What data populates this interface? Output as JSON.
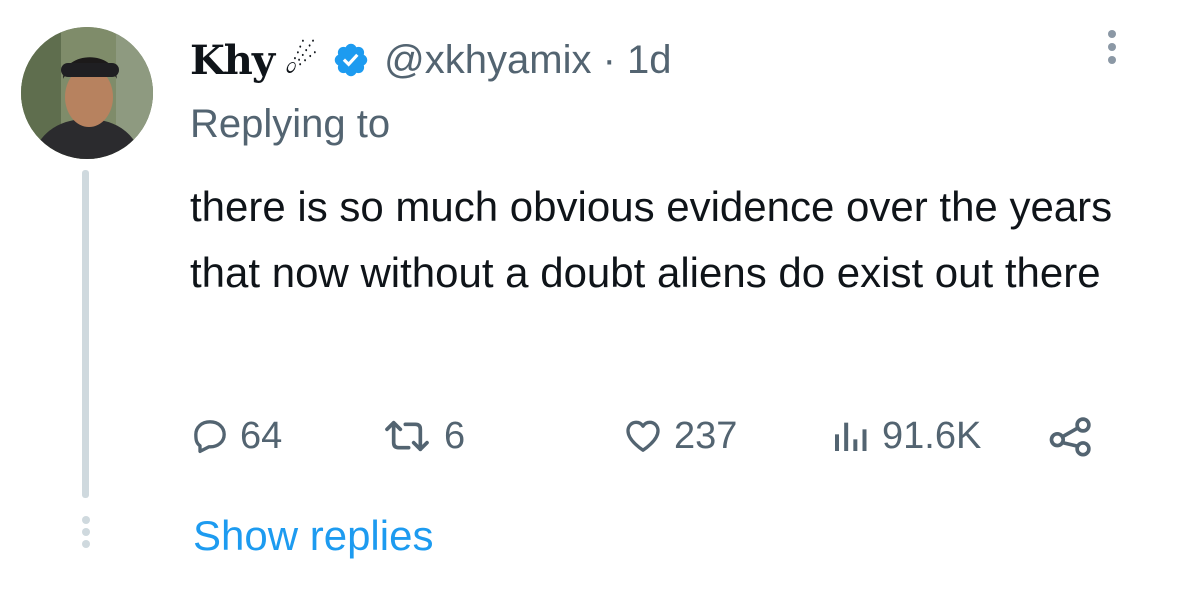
{
  "tweet": {
    "display_name": "Khy",
    "name_emoji": "☄",
    "handle_time": "@xkhyamix · 1d",
    "replying_to": "Replying to",
    "text": "there is so much obvious evidence over the years that now without a doubt aliens do exist out there"
  },
  "actions": {
    "replies": "64",
    "reposts": "6",
    "likes": "237",
    "views": "91.6K"
  },
  "footer": {
    "show_replies": "Show replies"
  },
  "colors": {
    "accent": "#1d9bf0",
    "verified": "#1d9bf0",
    "muted_text": "#536471",
    "thread_line": "#cfd9de"
  },
  "icons": [
    "avatar",
    "verified-badge-icon",
    "more-options-icon",
    "reply-icon",
    "repost-icon",
    "like-icon",
    "views-icon",
    "share-icon"
  ]
}
